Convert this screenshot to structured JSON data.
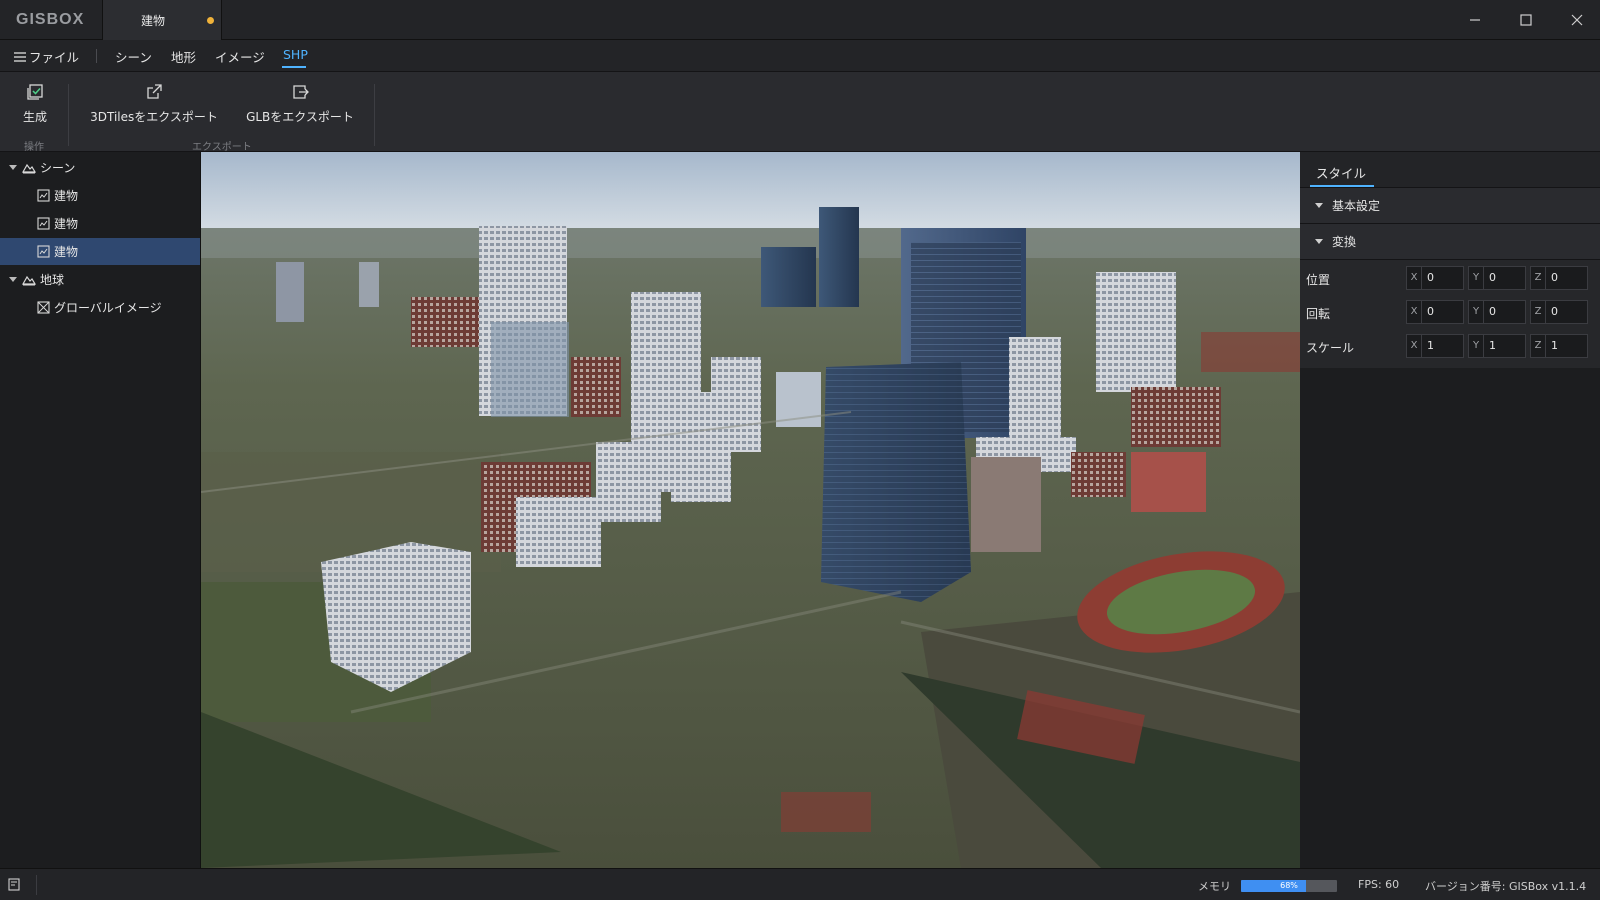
{
  "titlebar": {
    "logo": "GISBOX",
    "document_tab": "建物"
  },
  "menu": {
    "file": "ファイル",
    "items": [
      "シーン",
      "地形",
      "イメージ",
      "SHP"
    ],
    "active": "SHP"
  },
  "ribbon": {
    "generate": "生成",
    "group_operation": "操作",
    "export_3dtiles": "3DTilesをエクスポート",
    "export_glb": "GLBをエクスポート",
    "group_export": "エクスポート"
  },
  "tree": {
    "scene": "シーン",
    "building_1": "建物",
    "building_2": "建物",
    "building_3": "建物",
    "globe": "地球",
    "global_imagery": "グローバルイメージ"
  },
  "panel": {
    "tab": "スタイル",
    "section_basic": "基本設定",
    "section_transform": "変換",
    "position": {
      "label": "位置",
      "x": "0",
      "y": "0",
      "z": "0"
    },
    "rotation": {
      "label": "回転",
      "x": "0",
      "y": "0",
      "z": "0"
    },
    "scale": {
      "label": "スケール",
      "x": "1",
      "y": "1",
      "z": "1"
    },
    "axis_x": "X",
    "axis_y": "Y",
    "axis_z": "Z"
  },
  "status": {
    "memory_label": "メモリ",
    "memory_percent": "68%",
    "memory_value": 0.68,
    "fps": "FPS: 60",
    "version": "バージョン番号: GISBox v1.1.4"
  },
  "colors": {
    "accent": "#4fb3ff",
    "selected": "#2f4870",
    "unsaved_dot": "#f0b23a",
    "memory_fill": "#3f8ff2"
  }
}
